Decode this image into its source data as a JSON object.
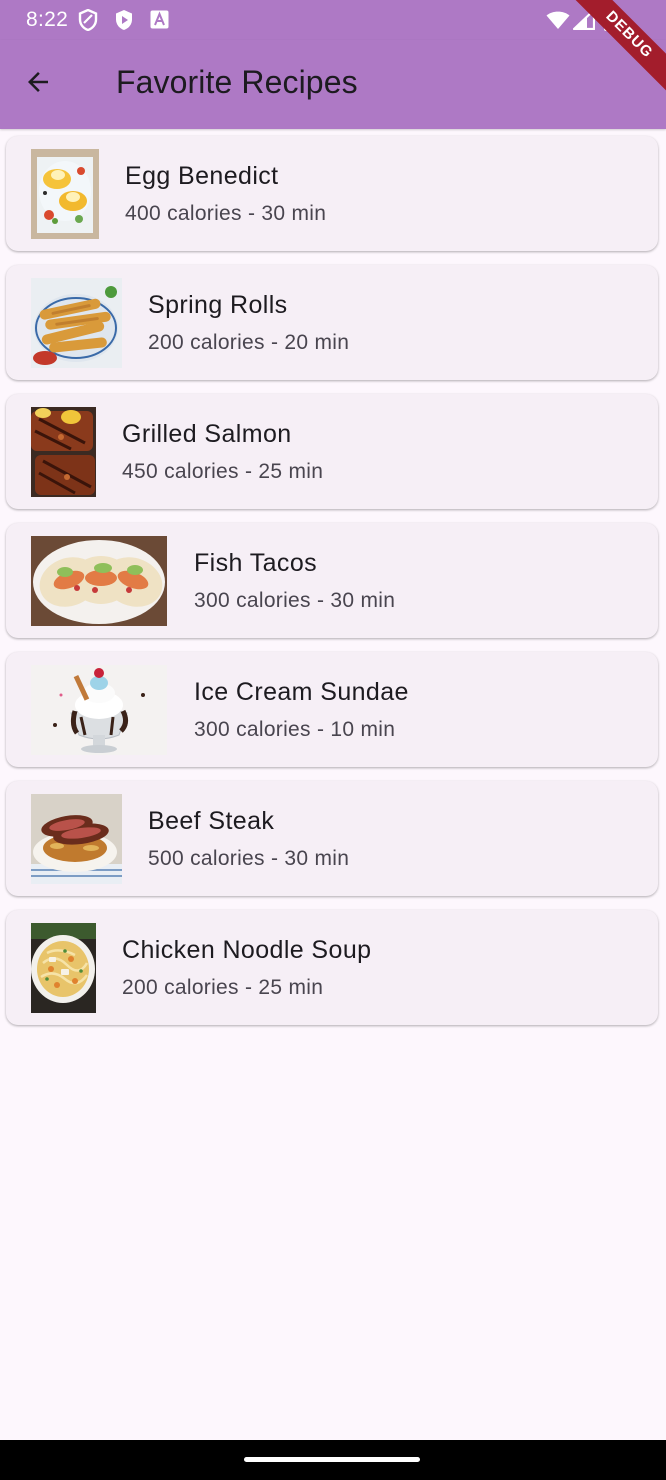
{
  "status_bar": {
    "time": "8:22",
    "icons": [
      "privacy-shield-icon",
      "play-protect-icon",
      "font-a-icon",
      "wifi-icon",
      "cellular-signal-icon",
      "battery-icon"
    ]
  },
  "app_bar": {
    "title": "Favorite Recipes",
    "back_icon": "arrow-back-icon",
    "background": "#ae79c5"
  },
  "debug_banner": {
    "label": "DEBUG",
    "color": "#a31d2c"
  },
  "recipes": [
    {
      "name": "Egg Benedict",
      "meta": "400 calories - 30 min",
      "image": "egg-benedict-photo"
    },
    {
      "name": "Spring Rolls",
      "meta": "200 calories - 20 min",
      "image": "spring-rolls-photo"
    },
    {
      "name": "Grilled Salmon",
      "meta": "450 calories - 25 min",
      "image": "grilled-salmon-photo"
    },
    {
      "name": "Fish Tacos",
      "meta": "300 calories - 30 min",
      "image": "fish-tacos-photo"
    },
    {
      "name": "Ice Cream Sundae",
      "meta": "300 calories - 10 min",
      "image": "ice-cream-sundae-photo"
    },
    {
      "name": "Beef Steak",
      "meta": "500 calories - 30 min",
      "image": "beef-steak-photo"
    },
    {
      "name": "Chicken Noodle Soup",
      "meta": "200 calories - 25 min",
      "image": "chicken-noodle-soup-photo"
    }
  ],
  "colors": {
    "page_background": "#fdf7fd",
    "card_background": "#f6eff6",
    "title_text": "#1d1b20",
    "subtitle_text": "#49454f"
  }
}
